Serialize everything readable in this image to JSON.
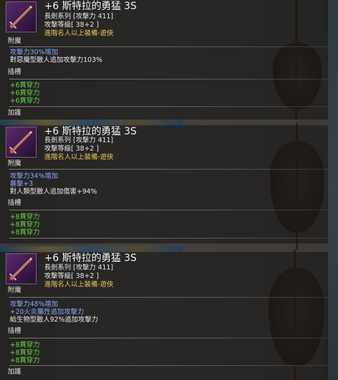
{
  "colors": {
    "title": "#f4f4f4",
    "requirement": "#e3c65a",
    "enchant": "#8aa7ff",
    "socket": "#62d640"
  },
  "item_icon": "sword-icon",
  "tooltips": [
    {
      "title": "+6 斯特拉的勇猛 3S",
      "type": "長劍系列 [攻擊力 411]",
      "level": "攻擊等級[ 38+2 ]",
      "requirement": "進階名人以上裝備-遊俠",
      "enchant_label": "附魔",
      "enchant_lines": [
        {
          "text": "攻擊力30%增加",
          "color": "blue"
        },
        {
          "text": "對惡魔型敵人追加攻擊力103%",
          "color": "white"
        }
      ],
      "socket_label": "插槽",
      "socket_lines": [
        "+6貫穿力",
        "+6貫穿力",
        "+6貫穿力"
      ],
      "bottom_label": "加護"
    },
    {
      "title": "+6 斯特拉的勇猛 3S",
      "type": "長劍系列 [攻擊力 411]",
      "level": "攻擊等級[ 38+2 ]",
      "requirement": "進階名人以上裝備-遊俠",
      "enchant_label": "附魔",
      "enchant_lines": [
        {
          "text": "攻擊力34%增加",
          "color": "blue"
        },
        {
          "text": "暴擊+3",
          "color": "blue"
        },
        {
          "text": "對人類型敵人追加傷害+94%",
          "color": "white"
        }
      ],
      "socket_label": "插槽",
      "socket_lines": [
        "+8貫穿力",
        "+8貫穿力",
        "+8貫穿力"
      ],
      "bottom_label": "加護"
    },
    {
      "title": "+6 斯特拉的勇猛 3S",
      "type": "長劍系列 [攻擊力 411]",
      "level": "攻擊等級[ 38+2 ]",
      "requirement": "進階名人以上裝備-遊俠",
      "enchant_label": "附魔",
      "enchant_lines": [
        {
          "text": "攻擊力48%增加",
          "color": "blue"
        },
        {
          "text": "+20火炎屬性追加攻擊力",
          "color": "blue"
        },
        {
          "text": "給生物型敵人92%追加攻擊力",
          "color": "white"
        }
      ],
      "socket_label": "插槽",
      "socket_lines": [
        "+8貫穿力",
        "+8貫穿力",
        "+8貫穿力"
      ],
      "bottom_label": "加護"
    }
  ]
}
